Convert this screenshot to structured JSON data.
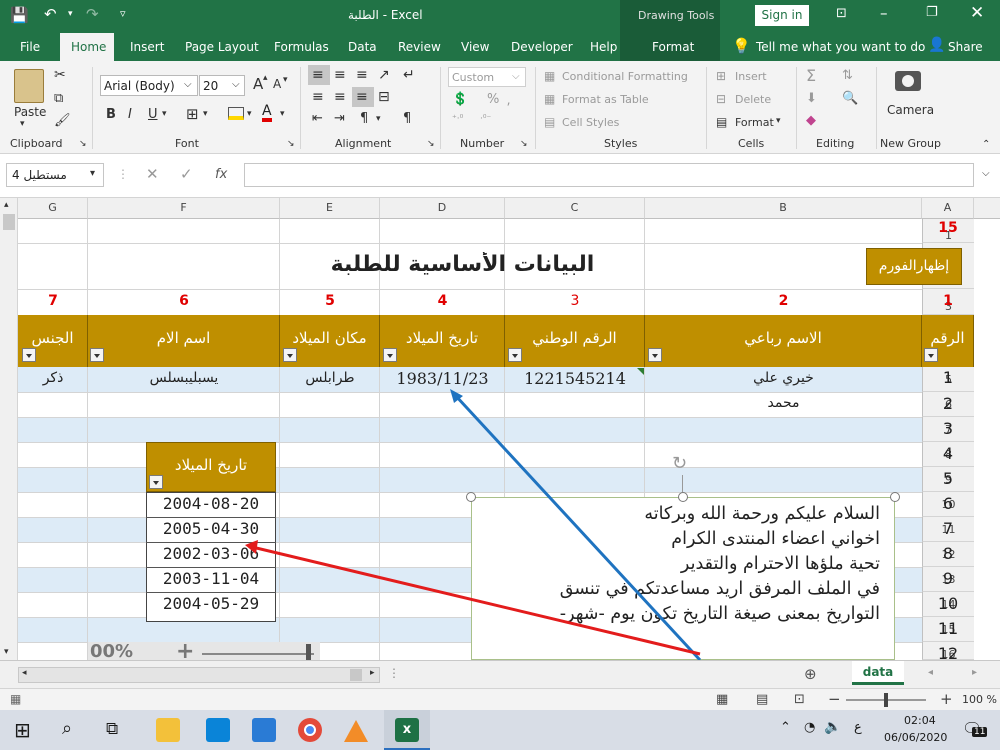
{
  "titlebar": {
    "file_title": "الطلبة  -  Excel",
    "drawing_tools": "Drawing Tools",
    "sign_in": "Sign in"
  },
  "tabs": [
    "File",
    "Home",
    "Insert",
    "Page Layout",
    "Formulas",
    "Data",
    "Review",
    "View",
    "Developer",
    "Help",
    "Format"
  ],
  "tell_me": "Tell me what you want to do",
  "share": "Share",
  "ribbon": {
    "paste": "Paste",
    "clipboard": "Clipboard",
    "font_name": "Arial (Body)",
    "font_size": "20",
    "font": "Font",
    "alignment": "Alignment",
    "number_format": "Custom",
    "number": "Number",
    "conditional_formatting": "Conditional Formatting",
    "format_as_table": "Format as Table",
    "cell_styles": "Cell Styles",
    "styles": "Styles",
    "insert": "Insert",
    "delete": "Delete",
    "format": "Format",
    "cells": "Cells",
    "editing": "Editing",
    "camera": "Camera",
    "new_group": "New Group",
    "bold": "B",
    "italic": "I",
    "underline": "U",
    "percent": "%",
    "font_grow": "A",
    "font_shrink": "A",
    "font_color": "A",
    "fx": "fx"
  },
  "name_box": "مستطيل 4",
  "columns": [
    "G",
    "F",
    "E",
    "D",
    "C",
    "B",
    "A"
  ],
  "rows": [
    "1",
    "2",
    "3",
    "4",
    "5",
    "6",
    "7",
    "8",
    "9",
    "10",
    "11",
    "12",
    "13",
    "14",
    "15",
    "16"
  ],
  "sheet": {
    "a1": "15",
    "title": "البيانات الأساسية للطلبة",
    "show_form_button": "إظهارالفورم",
    "col_numbers": [
      "7",
      "6",
      "5",
      "4",
      "3",
      "2",
      "1"
    ],
    "headers": [
      "الجنس",
      "اسم الام",
      "مكان الميلاد",
      "تاريخ الميلاد",
      "الرقم الوطني",
      "الاسم رباعي",
      "الرقم"
    ],
    "row5": [
      "ذكر",
      "يسبليبسلس",
      "طرابلس",
      "1983/11/23",
      "1221545214",
      "خيري علي",
      "1"
    ],
    "row6_name": "محمد",
    "seq": [
      "2",
      "3",
      "4",
      "5",
      "6",
      "7",
      "8",
      "9",
      "10",
      "11",
      "12"
    ],
    "date_table_header": "تاريخ الميلاد",
    "dates": [
      "2004-08-20",
      "2005-04-30",
      "2002-03-06",
      "2003-11-04",
      "2004-05-29"
    ],
    "textbox_lines": [
      "السلام عليكم ورحمة الله وبركاته",
      "اخواني اعضاء المنتدى الكرام",
      "تحية ملؤها الاحترام والتقدير",
      "في الملف المرفق اريد مساعدتكم في تنسق",
      "التواريخ بمعنى صيغة التاريخ تكون يوم -شهر-"
    ],
    "zoom_ghost": "00%"
  },
  "sheet_tab": "data",
  "zoom": "100 %",
  "taskbar": {
    "time": "02:04",
    "date": "06/06/2020",
    "lang": "ع",
    "notifications": "11"
  },
  "colors": {
    "excel_green": "#217346",
    "header_gold": "#bf8f00",
    "band_blue": "#ddebf7",
    "red_text": "#e00000",
    "arrow_blue": "#1f73c0",
    "arrow_red": "#e31c1c"
  }
}
